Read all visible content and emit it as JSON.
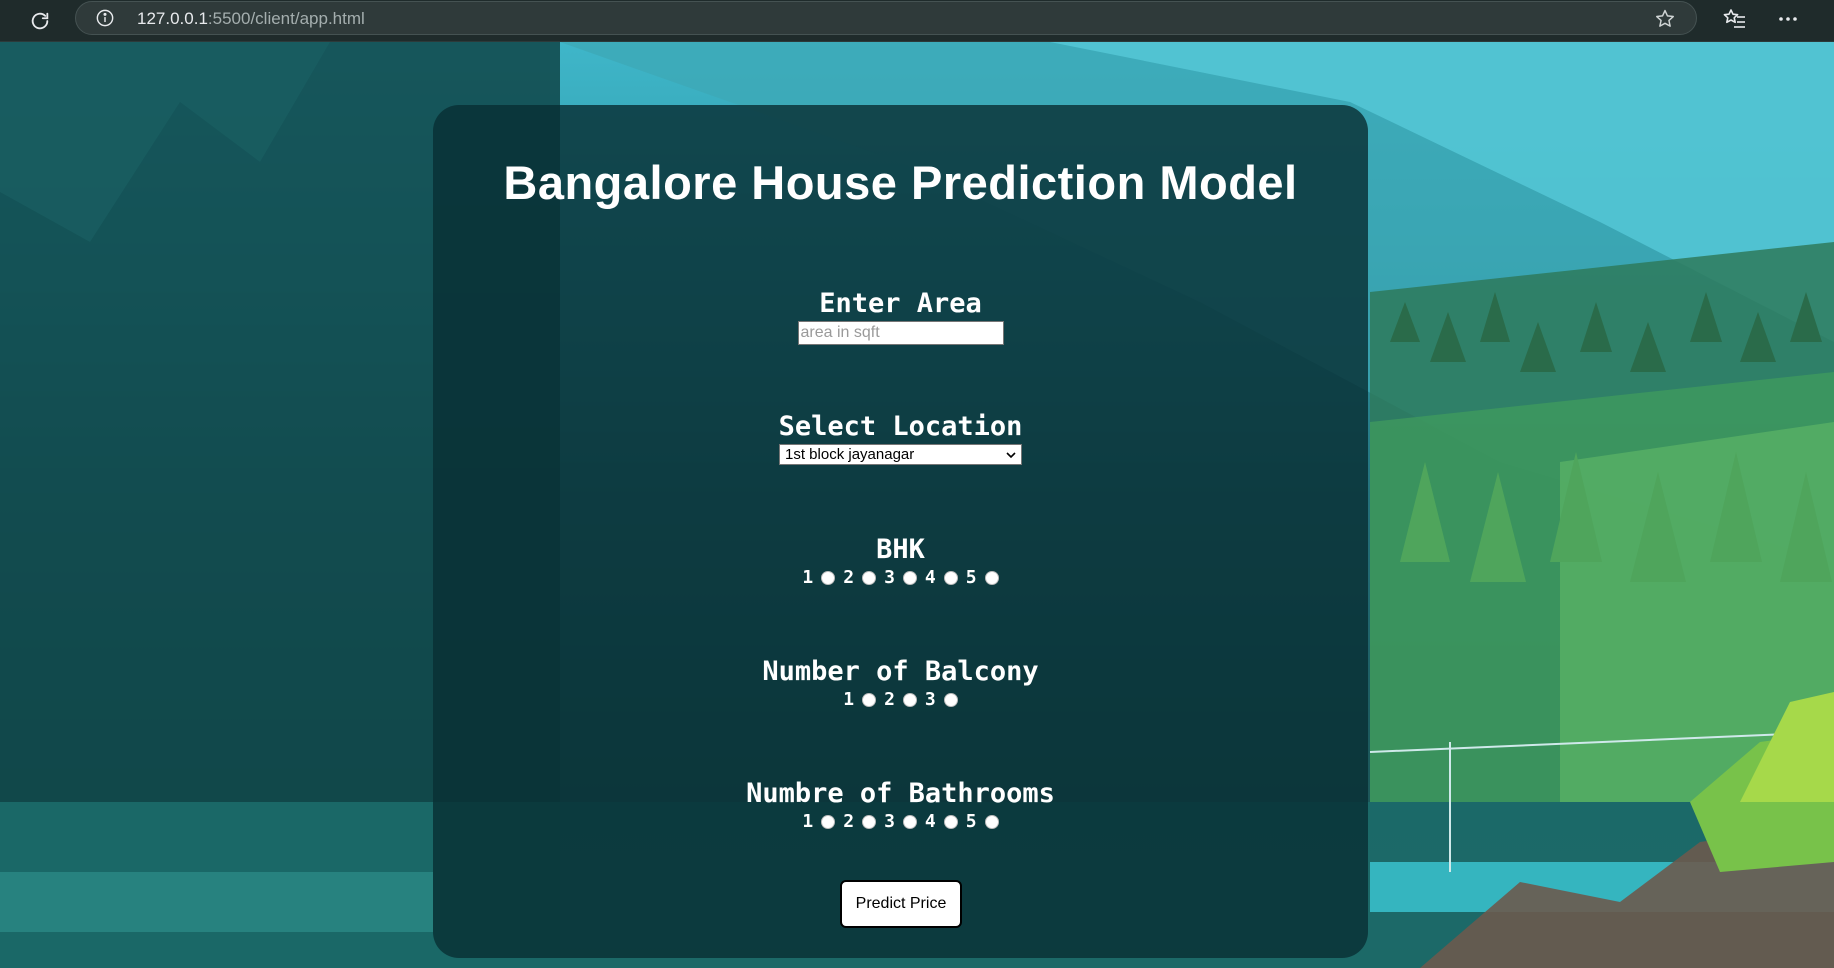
{
  "browser": {
    "url_host": "127.0.0.1",
    "url_path": ":5500/client/app.html"
  },
  "page": {
    "title": "Bangalore House Prediction Model",
    "area": {
      "label": "Enter Area",
      "placeholder": "area in sqft",
      "value": ""
    },
    "location": {
      "label": "Select Location",
      "selected": "1st block jayanagar"
    },
    "bhk": {
      "label": "BHK",
      "options": [
        "1",
        "2",
        "3",
        "4",
        "5"
      ]
    },
    "balcony": {
      "label": "Number of Balcony",
      "options": [
        "1",
        "2",
        "3"
      ]
    },
    "bathrooms": {
      "label": "Numbre of Bathrooms",
      "options": [
        "1",
        "2",
        "3",
        "4",
        "5"
      ]
    },
    "predict_button": "Predict Price"
  },
  "colors": {
    "card_bg": "#083034",
    "text": "#ffffff",
    "chrome_bg": "#1f2b2b"
  }
}
